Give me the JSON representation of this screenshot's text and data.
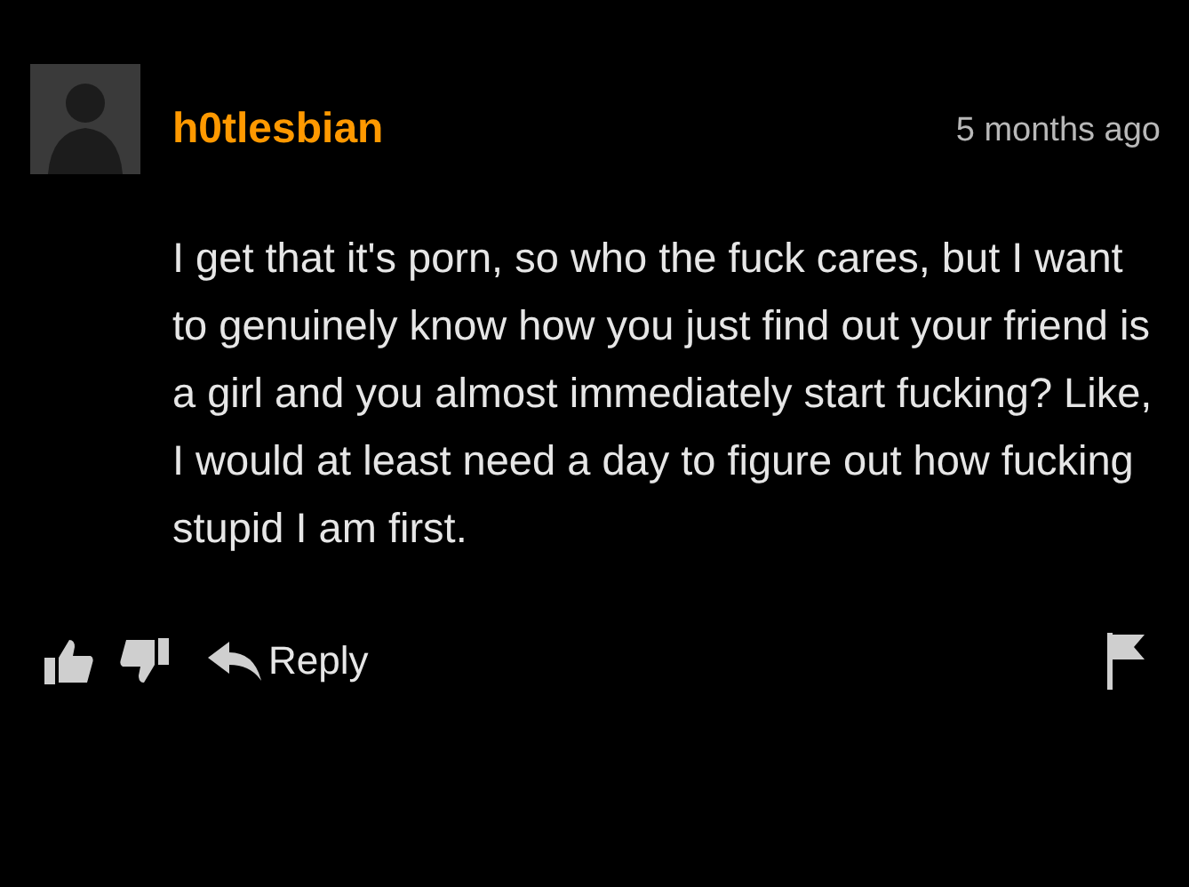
{
  "comment": {
    "username": "h0tlesbian",
    "time": "5 months ago",
    "body": "I get that it's porn, so who the fuck cares, but I want to genuinely know how you just find out your friend is a girl and you almost immediately start fucking? Like, I would at least need a day to figure out how fucking stupid I am first.",
    "reply_label": "Reply"
  }
}
